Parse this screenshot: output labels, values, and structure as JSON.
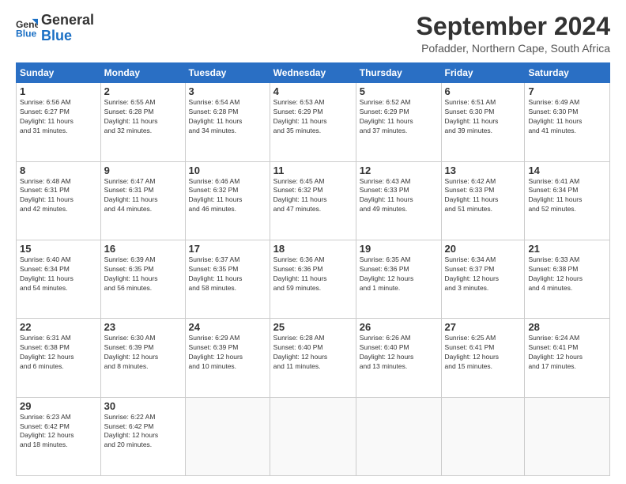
{
  "header": {
    "logo_line1": "General",
    "logo_line2": "Blue",
    "month": "September 2024",
    "location": "Pofadder, Northern Cape, South Africa"
  },
  "days_of_week": [
    "Sunday",
    "Monday",
    "Tuesday",
    "Wednesday",
    "Thursday",
    "Friday",
    "Saturday"
  ],
  "weeks": [
    [
      {
        "day": "1",
        "info": "Sunrise: 6:56 AM\nSunset: 6:27 PM\nDaylight: 11 hours\nand 31 minutes."
      },
      {
        "day": "2",
        "info": "Sunrise: 6:55 AM\nSunset: 6:28 PM\nDaylight: 11 hours\nand 32 minutes."
      },
      {
        "day": "3",
        "info": "Sunrise: 6:54 AM\nSunset: 6:28 PM\nDaylight: 11 hours\nand 34 minutes."
      },
      {
        "day": "4",
        "info": "Sunrise: 6:53 AM\nSunset: 6:29 PM\nDaylight: 11 hours\nand 35 minutes."
      },
      {
        "day": "5",
        "info": "Sunrise: 6:52 AM\nSunset: 6:29 PM\nDaylight: 11 hours\nand 37 minutes."
      },
      {
        "day": "6",
        "info": "Sunrise: 6:51 AM\nSunset: 6:30 PM\nDaylight: 11 hours\nand 39 minutes."
      },
      {
        "day": "7",
        "info": "Sunrise: 6:49 AM\nSunset: 6:30 PM\nDaylight: 11 hours\nand 41 minutes."
      }
    ],
    [
      {
        "day": "8",
        "info": "Sunrise: 6:48 AM\nSunset: 6:31 PM\nDaylight: 11 hours\nand 42 minutes."
      },
      {
        "day": "9",
        "info": "Sunrise: 6:47 AM\nSunset: 6:31 PM\nDaylight: 11 hours\nand 44 minutes."
      },
      {
        "day": "10",
        "info": "Sunrise: 6:46 AM\nSunset: 6:32 PM\nDaylight: 11 hours\nand 46 minutes."
      },
      {
        "day": "11",
        "info": "Sunrise: 6:45 AM\nSunset: 6:32 PM\nDaylight: 11 hours\nand 47 minutes."
      },
      {
        "day": "12",
        "info": "Sunrise: 6:43 AM\nSunset: 6:33 PM\nDaylight: 11 hours\nand 49 minutes."
      },
      {
        "day": "13",
        "info": "Sunrise: 6:42 AM\nSunset: 6:33 PM\nDaylight: 11 hours\nand 51 minutes."
      },
      {
        "day": "14",
        "info": "Sunrise: 6:41 AM\nSunset: 6:34 PM\nDaylight: 11 hours\nand 52 minutes."
      }
    ],
    [
      {
        "day": "15",
        "info": "Sunrise: 6:40 AM\nSunset: 6:34 PM\nDaylight: 11 hours\nand 54 minutes."
      },
      {
        "day": "16",
        "info": "Sunrise: 6:39 AM\nSunset: 6:35 PM\nDaylight: 11 hours\nand 56 minutes."
      },
      {
        "day": "17",
        "info": "Sunrise: 6:37 AM\nSunset: 6:35 PM\nDaylight: 11 hours\nand 58 minutes."
      },
      {
        "day": "18",
        "info": "Sunrise: 6:36 AM\nSunset: 6:36 PM\nDaylight: 11 hours\nand 59 minutes."
      },
      {
        "day": "19",
        "info": "Sunrise: 6:35 AM\nSunset: 6:36 PM\nDaylight: 12 hours\nand 1 minute."
      },
      {
        "day": "20",
        "info": "Sunrise: 6:34 AM\nSunset: 6:37 PM\nDaylight: 12 hours\nand 3 minutes."
      },
      {
        "day": "21",
        "info": "Sunrise: 6:33 AM\nSunset: 6:38 PM\nDaylight: 12 hours\nand 4 minutes."
      }
    ],
    [
      {
        "day": "22",
        "info": "Sunrise: 6:31 AM\nSunset: 6:38 PM\nDaylight: 12 hours\nand 6 minutes."
      },
      {
        "day": "23",
        "info": "Sunrise: 6:30 AM\nSunset: 6:39 PM\nDaylight: 12 hours\nand 8 minutes."
      },
      {
        "day": "24",
        "info": "Sunrise: 6:29 AM\nSunset: 6:39 PM\nDaylight: 12 hours\nand 10 minutes."
      },
      {
        "day": "25",
        "info": "Sunrise: 6:28 AM\nSunset: 6:40 PM\nDaylight: 12 hours\nand 11 minutes."
      },
      {
        "day": "26",
        "info": "Sunrise: 6:26 AM\nSunset: 6:40 PM\nDaylight: 12 hours\nand 13 minutes."
      },
      {
        "day": "27",
        "info": "Sunrise: 6:25 AM\nSunset: 6:41 PM\nDaylight: 12 hours\nand 15 minutes."
      },
      {
        "day": "28",
        "info": "Sunrise: 6:24 AM\nSunset: 6:41 PM\nDaylight: 12 hours\nand 17 minutes."
      }
    ],
    [
      {
        "day": "29",
        "info": "Sunrise: 6:23 AM\nSunset: 6:42 PM\nDaylight: 12 hours\nand 18 minutes."
      },
      {
        "day": "30",
        "info": "Sunrise: 6:22 AM\nSunset: 6:42 PM\nDaylight: 12 hours\nand 20 minutes."
      },
      {
        "day": "",
        "info": ""
      },
      {
        "day": "",
        "info": ""
      },
      {
        "day": "",
        "info": ""
      },
      {
        "day": "",
        "info": ""
      },
      {
        "day": "",
        "info": ""
      }
    ]
  ]
}
